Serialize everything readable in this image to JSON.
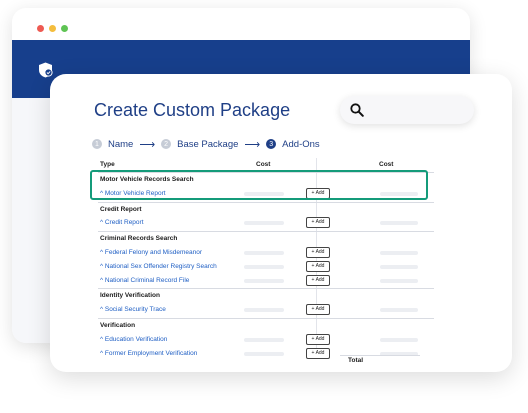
{
  "background_window": {
    "nav_color": "#173f8c",
    "logo_icon": "shield-check-icon"
  },
  "card": {
    "title": "Create Custom Package",
    "search_icon": "search-icon"
  },
  "steps": [
    {
      "number": "1",
      "label": "Name",
      "active": false
    },
    {
      "number": "2",
      "label": "Base Package",
      "active": false
    },
    {
      "number": "3",
      "label": "Add-Ons",
      "active": true
    }
  ],
  "table": {
    "headers": {
      "type": "Type",
      "cost": "Cost",
      "cost2": "Cost"
    },
    "groups": [
      {
        "label": "Motor Vehicle Records Search",
        "items": [
          "^ Motor Vehicle Report"
        ]
      },
      {
        "label": "Credit Report",
        "items": [
          "^ Credit Report"
        ]
      },
      {
        "label": "Criminal Records Search",
        "items": [
          "^ Federal Felony and Misdemeanor",
          "^ National Sex Offender Registry Search",
          "^ National Criminal Record File"
        ]
      },
      {
        "label": "Identity Verification",
        "items": [
          "^ Social Security Trace"
        ]
      },
      {
        "label": "Verification",
        "items": [
          "^ Education Verification",
          "^ Former Employment Verification"
        ]
      }
    ],
    "add_label": "+ Add",
    "total_label": "Total"
  },
  "highlight_color": "#149b7a"
}
